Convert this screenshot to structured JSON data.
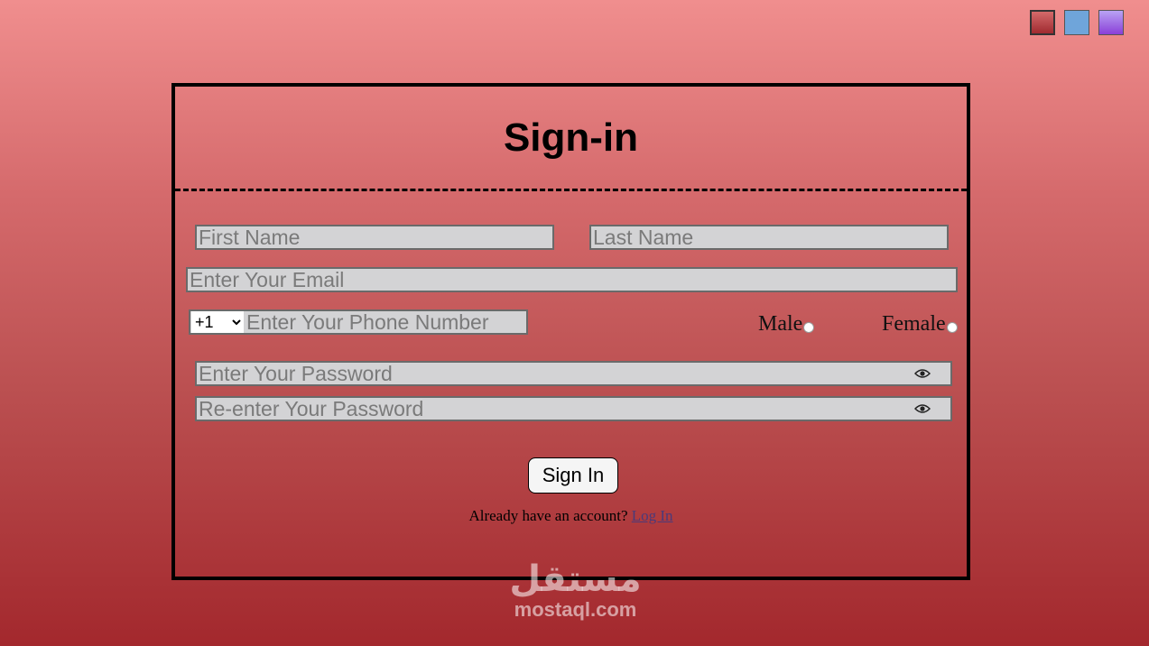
{
  "theme_switcher": {
    "swatches": [
      {
        "name": "red",
        "color": "#c0494c"
      },
      {
        "name": "blue",
        "color": "#6fa5da"
      },
      {
        "name": "purple",
        "color": "#9b5ce0"
      }
    ]
  },
  "form": {
    "title": "Sign-in",
    "first_name_placeholder": "First Name",
    "last_name_placeholder": "Last Name",
    "email_placeholder": "Enter Your Email",
    "country_code": "+1",
    "phone_placeholder": "Enter Your Phone Number",
    "gender_male": "Male",
    "gender_female": "Female",
    "password_placeholder": "Enter Your Password",
    "confirm_password_placeholder": "Re-enter Your Password",
    "show_password_icon": "eye-icon",
    "submit_label": "Sign In",
    "login_prompt": "Already have an account? ",
    "login_link": "Log In"
  },
  "watermark": {
    "arabic": "مستقل",
    "latin": "mostaql.com"
  }
}
